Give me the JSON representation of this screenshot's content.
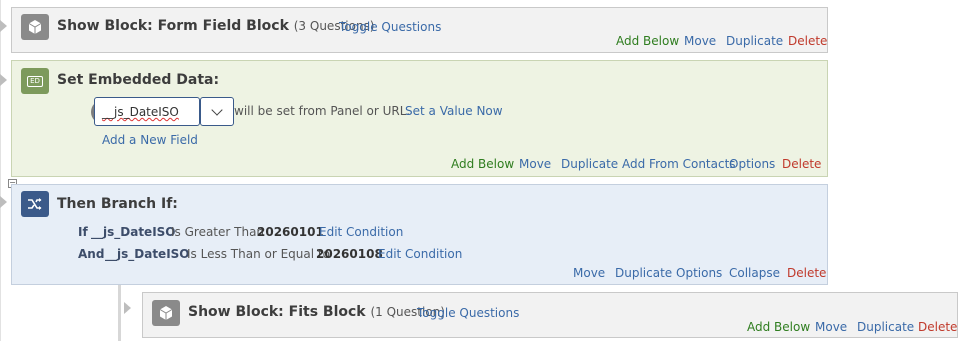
{
  "block1": {
    "title": "Show Block: Form Field Block",
    "subtitle": "(3 Questions)",
    "toggle": "Toggle Questions",
    "actions": {
      "add_below": "Add Below",
      "move": "Move",
      "duplicate": "Duplicate",
      "delete": "Delete"
    }
  },
  "embedded": {
    "title": "Set Embedded Data:",
    "badge_text": "ED",
    "field_value": "__js_DateISO",
    "set_from": "will be set from Panel or URL.",
    "set_value": "Set a Value Now",
    "add_field": "Add a New Field",
    "actions": {
      "add_below": "Add Below",
      "move": "Move",
      "duplicate": "Duplicate",
      "add_from_contacts": "Add From Contacts",
      "options": "Options",
      "delete": "Delete"
    }
  },
  "branch": {
    "title": "Then Branch If:",
    "conditions": [
      {
        "connector": "If",
        "field": "__js_DateISO",
        "operator": "Is Greater Than",
        "value": "20260101",
        "edit": "Edit Condition"
      },
      {
        "connector": "And",
        "field": "__js_DateISO",
        "operator": "Is Less Than or Equal to",
        "value": "20260108",
        "edit": "Edit Condition"
      }
    ],
    "actions": {
      "move": "Move",
      "duplicate": "Duplicate",
      "options": "Options",
      "collapse": "Collapse",
      "delete": "Delete"
    }
  },
  "block2": {
    "title": "Show Block: Fits Block",
    "subtitle": "(1 Question)",
    "toggle": "Toggle Questions",
    "actions": {
      "add_below": "Add Below",
      "move": "Move",
      "duplicate": "Duplicate",
      "delete": "Delete"
    }
  },
  "colors": {
    "link": "#3a6aa8",
    "add": "#2f7d1f",
    "delete": "#c0392b"
  }
}
